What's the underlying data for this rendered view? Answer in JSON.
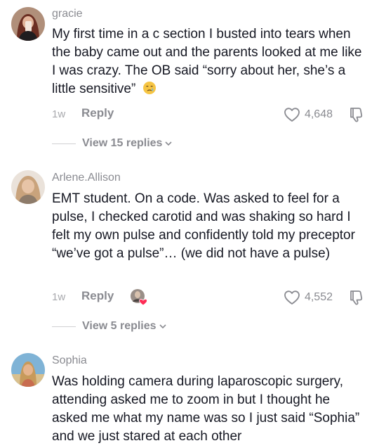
{
  "comments": [
    {
      "username": "gracie",
      "text": "My first time in a c section I busted into tears when the baby came out and the parents looked at me like I was crazy. The OB said “sorry about her, she’s a little sensitive”",
      "emoji": "crying-face",
      "time": "1w",
      "reply_label": "Reply",
      "likes": "4,648",
      "view_replies": "View 15 replies"
    },
    {
      "username": "Arlene.Allison",
      "text": "EMT student. On a code. Was asked to feel for a pulse, I checked carotid and was shaking so hard I felt my own pulse and confidently told my preceptor “we’ve got a pulse”… (we did not have a pulse)",
      "time": "1w",
      "reply_label": "Reply",
      "likes": "4,552",
      "view_replies": "View 5 replies"
    },
    {
      "username": "Sophia",
      "text": "Was holding camera during laparoscopic surgery, attending asked me to zoom in but I thought he asked me what my name was so I just said “Sophia” and we just stared at each other"
    }
  ],
  "colors": {
    "text": "#161823",
    "secondary": "#8a8b91",
    "heart_badge": "#fe2c55"
  }
}
